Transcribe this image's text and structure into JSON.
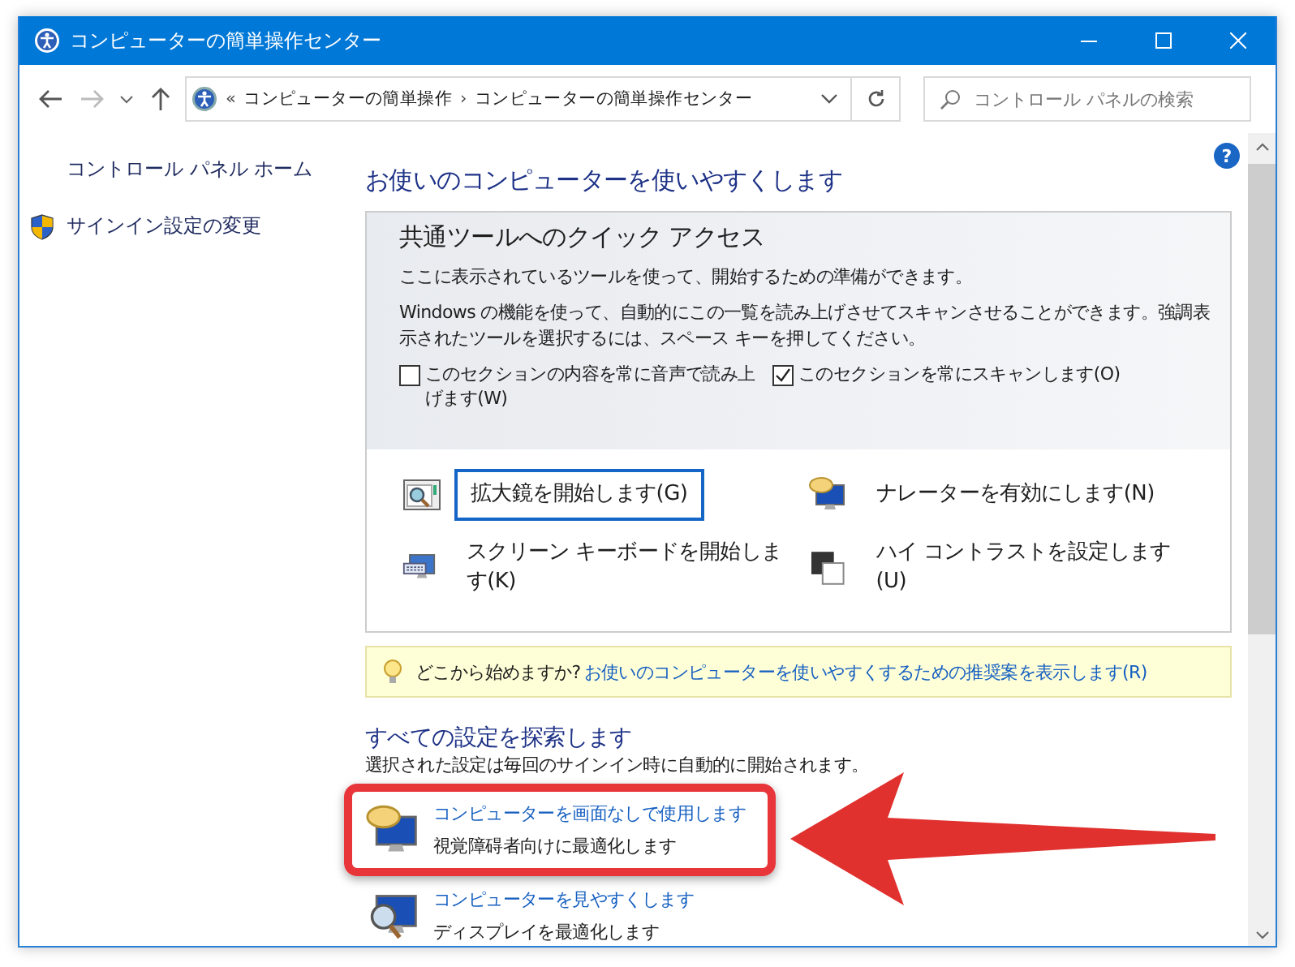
{
  "window": {
    "title": "コンピューターの簡単操作センター"
  },
  "address_bar": {
    "overflow": "«",
    "separator": "›",
    "crumbs": [
      "コンピューターの簡単操作",
      "コンピューターの簡単操作センター"
    ]
  },
  "search": {
    "placeholder": "コントロール パネルの検索"
  },
  "help": "?",
  "sidebar": {
    "items": [
      {
        "label": "コントロール パネル ホーム",
        "kind": "plain"
      },
      {
        "label": "サインイン設定の変更",
        "kind": "shield"
      }
    ]
  },
  "main": {
    "heading": "お使いのコンピューターを使いやすくします",
    "quick_access": {
      "title": "共通ツールへのクイック アクセス",
      "lines": [
        "ここに表示されているツールを使って、開始するための準備ができます。",
        "Windows の機能を使って、自動的にこの一覧を読み上げさせてスキャンさせることができます。強調表示されたツールを選択するには、スペース キーを押してください。"
      ],
      "checkboxes": [
        {
          "label": "このセクションの内容を常に音声で読み上げます(W)",
          "checked": false
        },
        {
          "label": "このセクションを常にスキャンします(O)",
          "checked": true
        }
      ],
      "tools": [
        {
          "label": "拡大鏡を開始します(G)",
          "kind": "magnifier",
          "focused": true
        },
        {
          "label": "ナレーターを有効にします(N)",
          "kind": "narrator",
          "focused": false
        },
        {
          "label": "スクリーン キーボードを開始します(K)",
          "kind": "keyboard",
          "focused": false
        },
        {
          "label": "ハイ コントラストを設定します(U)",
          "kind": "contrast",
          "focused": false
        }
      ]
    },
    "tip": {
      "prefix": "どこから始めますか?",
      "link": "お使いのコンピューターを使いやすくするための推奨案を表示します(R)"
    },
    "explore": {
      "heading": "すべての設定を探索します",
      "description": "選択された設定は毎回のサインイン時に自動的に開始されます。",
      "items": [
        {
          "title": "コンピューターを画面なしで使用します",
          "subtitle": "視覚障碍者向けに最適化します",
          "kind": "narrator",
          "highlighted": true
        },
        {
          "title": "コンピューターを見やすくします",
          "subtitle": "ディスプレイを最適化します",
          "kind": "magnifier",
          "highlighted": false
        }
      ]
    }
  }
}
